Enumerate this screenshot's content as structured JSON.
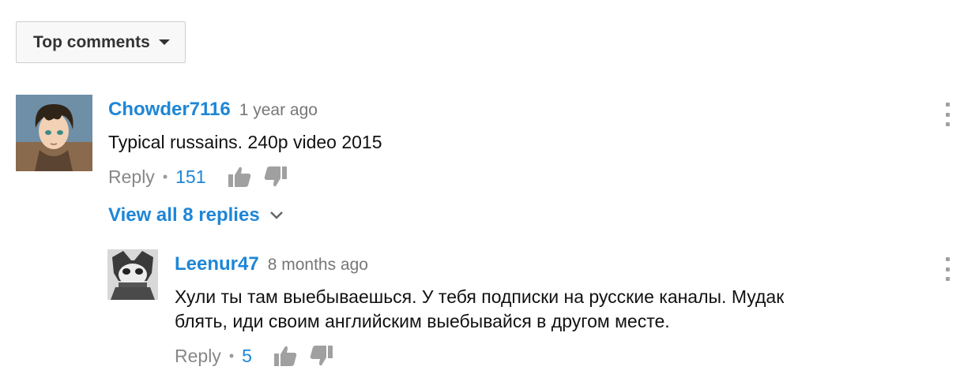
{
  "sort": {
    "label": "Top comments"
  },
  "comments": [
    {
      "author": "Chowder7116",
      "time": "1 year ago",
      "text": "Typical russains. 240p video 2015",
      "reply_label": "Reply",
      "separator": "•",
      "likes": "151",
      "view_replies": "View all 8 replies"
    },
    {
      "author": "Leenur47",
      "time": "8 months ago",
      "text": "Хули ты там выебываешься. У тебя подписки на русские каналы. Мудак\nблять, иди своим английским выебывайся в другом месте.",
      "reply_label": "Reply",
      "separator": "•",
      "likes": "5"
    }
  ],
  "colors": {
    "link_blue": "#1e86d6",
    "muted_gray": "#888888",
    "icon_gray": "#a0a0a0"
  }
}
